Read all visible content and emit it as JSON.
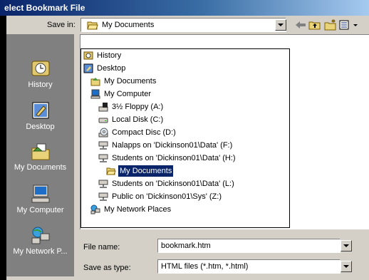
{
  "window": {
    "title": "elect Bookmark File"
  },
  "savein": {
    "label": "Save in:",
    "value": "My Documents"
  },
  "places": [
    {
      "label": "History",
      "icon": "history-icon"
    },
    {
      "label": "Desktop",
      "icon": "desktop-icon"
    },
    {
      "label": "My Documents",
      "icon": "my-documents-icon"
    },
    {
      "label": "My Computer",
      "icon": "my-computer-icon"
    },
    {
      "label": "My Network P...",
      "icon": "network-places-icon"
    }
  ],
  "dropdown": {
    "items": [
      {
        "label": "History",
        "icon": "history-icon"
      },
      {
        "label": "Desktop",
        "icon": "desktop-icon"
      },
      {
        "label": "My Documents",
        "icon": "my-documents-icon"
      },
      {
        "label": "My Computer",
        "icon": "my-computer-icon"
      },
      {
        "label": "3½ Floppy (A:)",
        "icon": "floppy-drive-icon"
      },
      {
        "label": "Local Disk (C:)",
        "icon": "hard-disk-icon"
      },
      {
        "label": "Compact Disc (D:)",
        "icon": "cd-drive-icon"
      },
      {
        "label": "Nalapps on 'Dickinson01\\Data' (F:)",
        "icon": "network-drive-icon"
      },
      {
        "label": "Students on 'Dickinson01\\Data' (H:)",
        "icon": "network-drive-icon"
      },
      {
        "label": "My Documents",
        "icon": "folder-open-icon",
        "selected": true
      },
      {
        "label": "Students on 'Dickinson01\\Data' (L:)",
        "icon": "network-drive-icon"
      },
      {
        "label": "Public on 'Dickinson01\\Sys' (Z:)",
        "icon": "network-drive-icon"
      },
      {
        "label": "My Network Places",
        "icon": "network-places-icon"
      }
    ]
  },
  "filename": {
    "label": "File name:",
    "value": "bookmark.htm"
  },
  "filetype": {
    "label": "Save as type:",
    "value": "HTML files (*.htm, *.html)"
  },
  "colors": {
    "title_start": "#0a246a",
    "title_end": "#a6caf0",
    "selection": "#0a246a",
    "places_bar": "#808080",
    "face": "#d4d0c8"
  }
}
